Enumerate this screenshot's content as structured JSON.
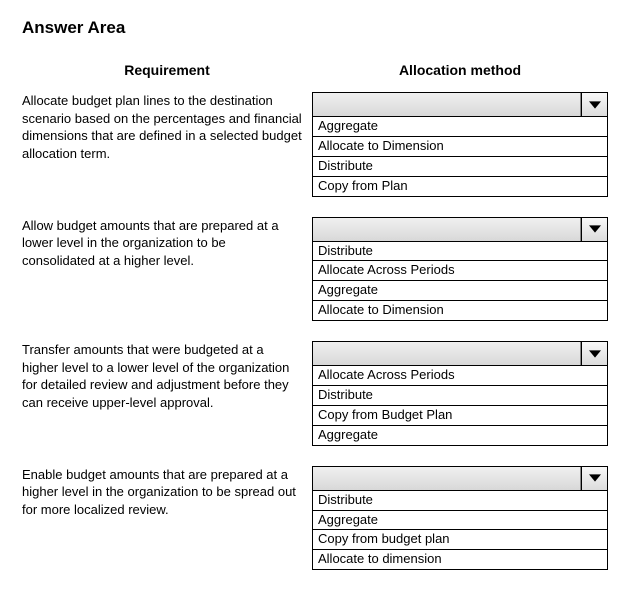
{
  "title": "Answer Area",
  "headers": {
    "left": "Requirement",
    "right": "Allocation method"
  },
  "rows": [
    {
      "requirement": "Allocate budget plan lines to the destination scenario based on the percentages and financial dimensions that are defined in a selected budget allocation term.",
      "options": [
        "Aggregate",
        "Allocate to Dimension",
        "Distribute",
        "Copy from Plan"
      ]
    },
    {
      "requirement": "Allow budget amounts that are prepared at a lower level in the organization to be consolidated at a higher level.",
      "options": [
        "Distribute",
        "Allocate Across Periods",
        "Aggregate",
        "Allocate to Dimension"
      ]
    },
    {
      "requirement": "Transfer amounts that were budgeted at a higher level to a lower level of the organization for detailed review and adjustment before they can receive upper-level approval.",
      "options": [
        "Allocate Across Periods",
        "Distribute",
        "Copy from Budget Plan",
        "Aggregate"
      ]
    },
    {
      "requirement": "Enable budget amounts that are prepared at a higher level in the organization to be spread out for more localized review.",
      "options": [
        "Distribute",
        "Aggregate",
        "Copy from budget plan",
        "Allocate to dimension"
      ]
    }
  ]
}
